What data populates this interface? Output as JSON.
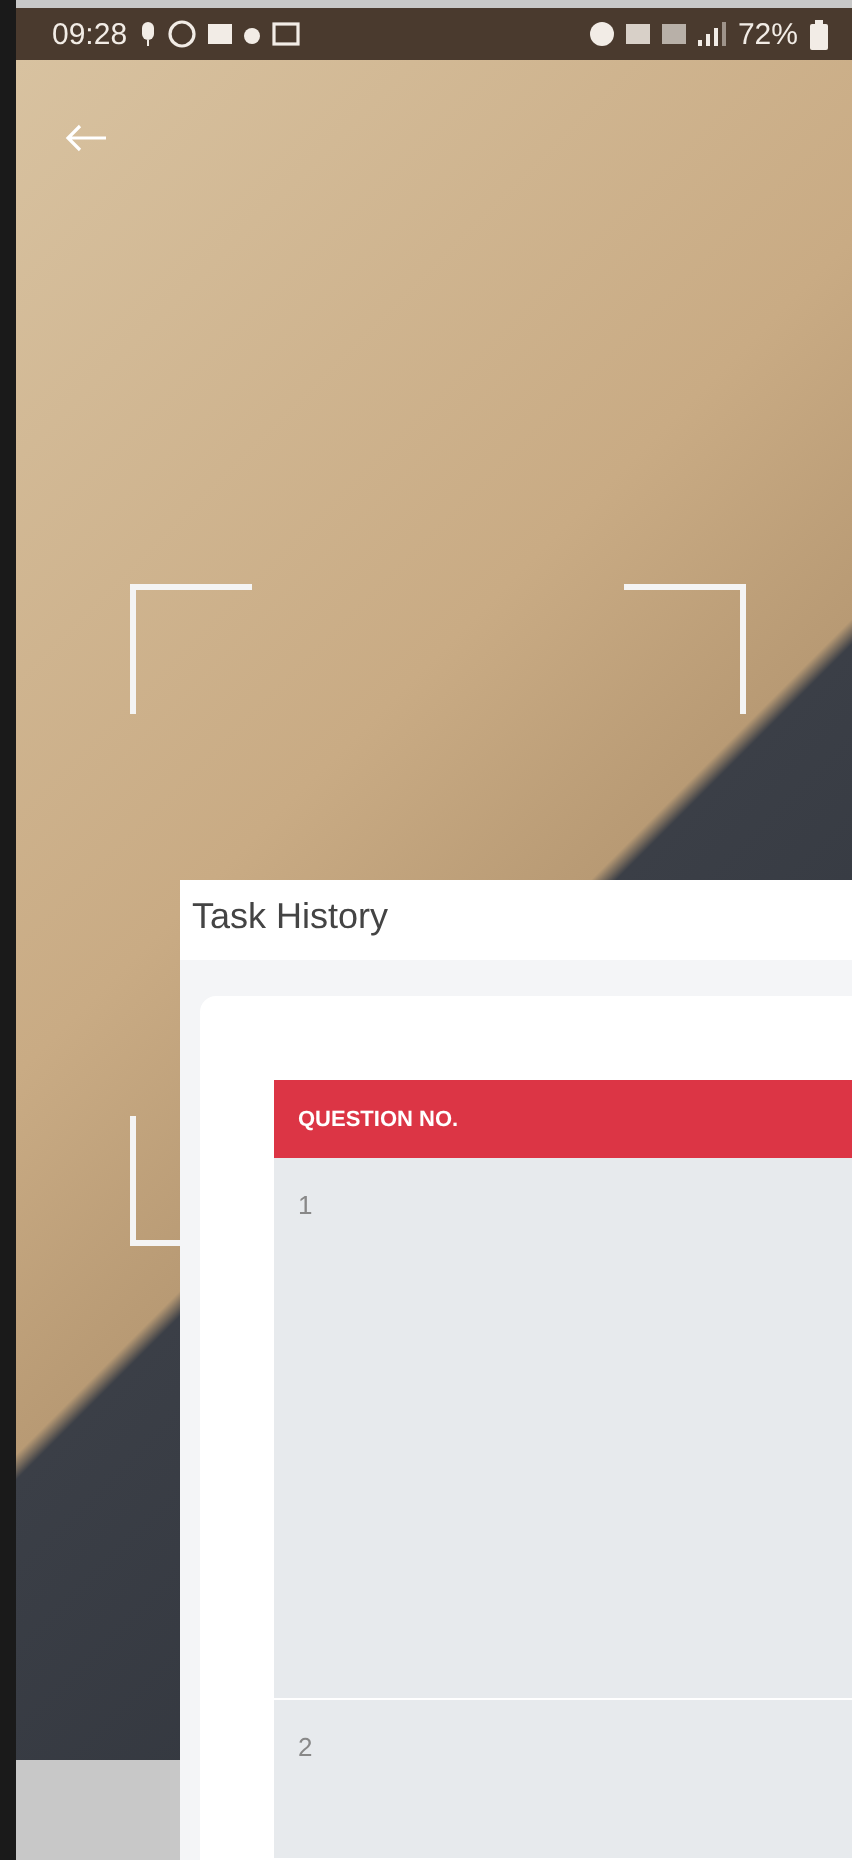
{
  "status_bar": {
    "time": "09:28",
    "battery": "72%"
  },
  "panel": {
    "title": "Task History"
  },
  "table": {
    "columns": [
      "QUESTION NO."
    ],
    "rows": [
      {
        "question_no": "1"
      },
      {
        "question_no": "2"
      }
    ]
  }
}
